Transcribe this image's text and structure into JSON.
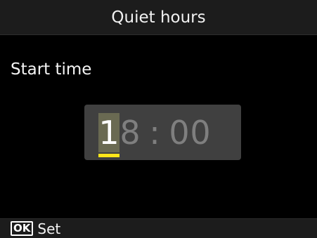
{
  "header": {
    "title": "Quiet hours"
  },
  "prompt": {
    "label": "Start time"
  },
  "time_entry": {
    "digits": [
      "1",
      "8",
      "0",
      "0"
    ],
    "separator": ":",
    "active_digit_index": 0
  },
  "footer": {
    "ok_key_label": "OK",
    "action_label": "Set"
  },
  "colors": {
    "background": "#000000",
    "bar": "#1c1c1c",
    "time_box": "#404040",
    "active_digit_bg": "#6a6a52",
    "cursor": "#ffe51a",
    "inactive_digit": "#7f7f7f"
  }
}
